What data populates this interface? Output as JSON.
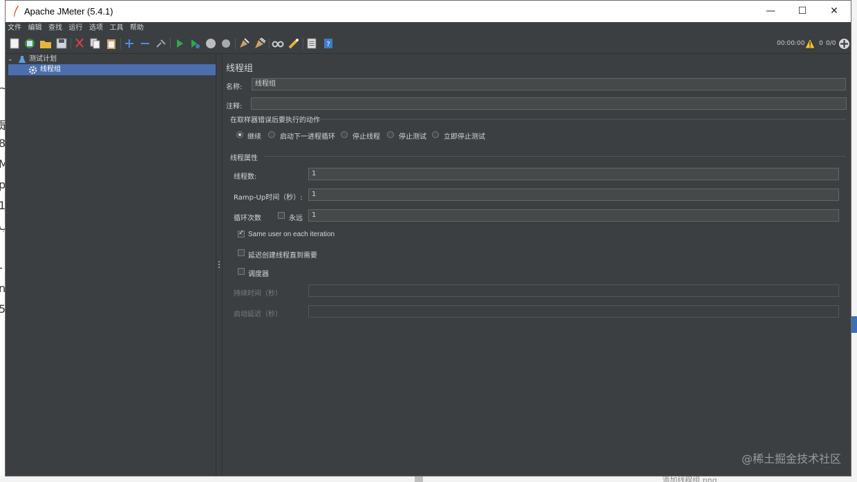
{
  "window": {
    "title": "Apache JMeter (5.4.1)",
    "controls": {
      "minimize": "—",
      "maximize": "☐",
      "close": "✕"
    }
  },
  "menu": [
    "文件",
    "编辑",
    "查找",
    "运行",
    "选项",
    "工具",
    "帮助"
  ],
  "toolbar": {
    "icons": [
      "new-icon",
      "templates-icon",
      "open-icon",
      "save-icon",
      "cut-icon",
      "copy-icon",
      "paste-icon",
      "expand-icon",
      "collapse-icon",
      "toggle-icon",
      "start-icon",
      "start-no-pause-icon",
      "stop-icon",
      "shutdown-icon",
      "clear-icon",
      "clear-all-icon",
      "search-icon",
      "reset-search-icon",
      "function-helper-icon",
      "help-icon"
    ],
    "timer": "00:00:00",
    "warning_count": "0",
    "threads": "0/0"
  },
  "tree": {
    "root": "测试计划",
    "child": "线程组"
  },
  "panel": {
    "heading": "线程组",
    "name_label": "名称:",
    "name_value": "线程组",
    "comment_label": "注释:",
    "comment_value": "",
    "on_error_group": "在取样器错误后要执行的动作",
    "on_error_options": [
      "继续",
      "启动下一进程循环",
      "停止线程",
      "停止测试",
      "立即停止测试"
    ],
    "selected_option": "继续",
    "thread_props_group": "线程属性",
    "threads_label": "线程数:",
    "threads_value": "1",
    "rampup_label": "Ramp-Up时间（秒）:",
    "rampup_value": "1",
    "loop_label": "循环次数",
    "forever_label": "永远",
    "loop_value": "1",
    "same_user_label": "Same user on each iteration",
    "delay_label": "延迟创建线程直到需要",
    "scheduler_label": "调度器",
    "duration_label": "持续时间（秒）",
    "startup_delay_label": "启动延迟（秒）"
  },
  "watermark": "@稀土掘金技术社区",
  "background_caption": "添加线程组.png",
  "colors": {
    "window_bg": "#3c3f41",
    "field_bg": "#45494a",
    "selection": "#4b6eaf",
    "text": "#d4d4d4"
  }
}
